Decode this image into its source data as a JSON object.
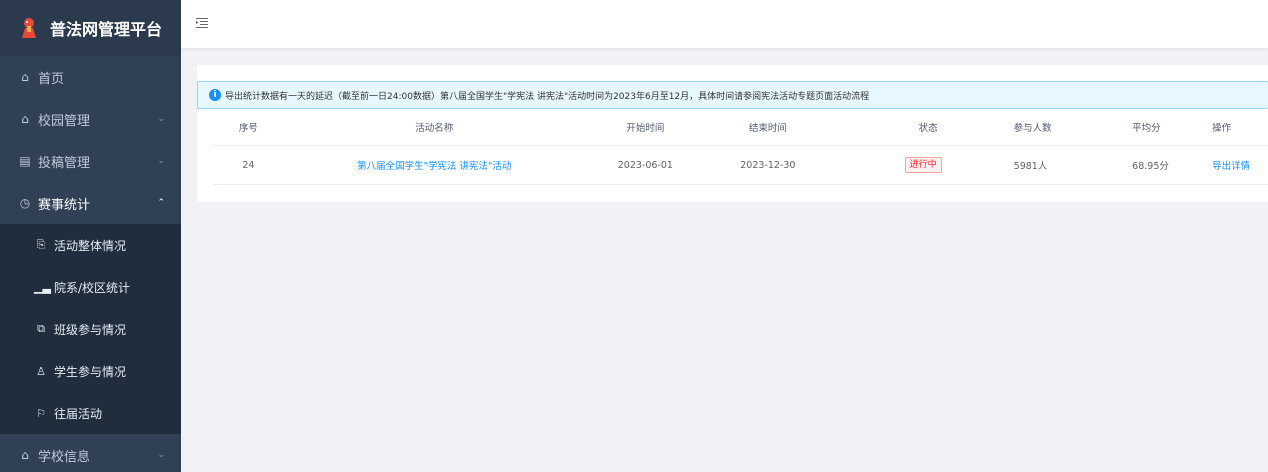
{
  "app": {
    "title": "普法网管理平台"
  },
  "sidebar": {
    "items": [
      {
        "label": "首页",
        "icon": "home-icon"
      },
      {
        "label": "校园管理",
        "icon": "home-icon",
        "arrow": "chevron-down-icon"
      },
      {
        "label": "投稿管理",
        "icon": "document-icon",
        "arrow": "chevron-down-icon"
      },
      {
        "label": "赛事统计",
        "icon": "clock-icon",
        "arrow": "chevron-up-icon"
      }
    ],
    "submenu": [
      {
        "label": "活动整体情况",
        "icon": "report-icon"
      },
      {
        "label": "院系/校区统计",
        "icon": "bar-chart-icon"
      },
      {
        "label": "班级参与情况",
        "icon": "class-icon"
      },
      {
        "label": "学生参与情况",
        "icon": "user-icon"
      },
      {
        "label": "往届活动",
        "icon": "flag-icon"
      }
    ],
    "last_item": {
      "label": "学校信息",
      "icon": "bank-icon"
    }
  },
  "alert": {
    "text": "导出统计数据有一天的延迟（截至前一日24:00数据）第八届全国学生\"学宪法 讲宪法\"活动时间为2023年6月至12月，具体时间请参阅宪法活动专题页面活动流程"
  },
  "table": {
    "headers": [
      "序号",
      "活动名称",
      "开始时间",
      "结束时间",
      "状态",
      "参与人数",
      "平均分",
      "操作"
    ],
    "rows": [
      {
        "index": "24",
        "name": "第八届全国学生\"学宪法 讲宪法\"活动",
        "start": "2023-06-01",
        "end": "2023-12-30",
        "status": "进行中",
        "participants": "5981人",
        "avg": "68.95分",
        "action": "导出详情"
      }
    ]
  },
  "colors": {
    "sidebar_bg": "#304156",
    "accent": "#1890ff",
    "status_red": "#f5222d"
  }
}
